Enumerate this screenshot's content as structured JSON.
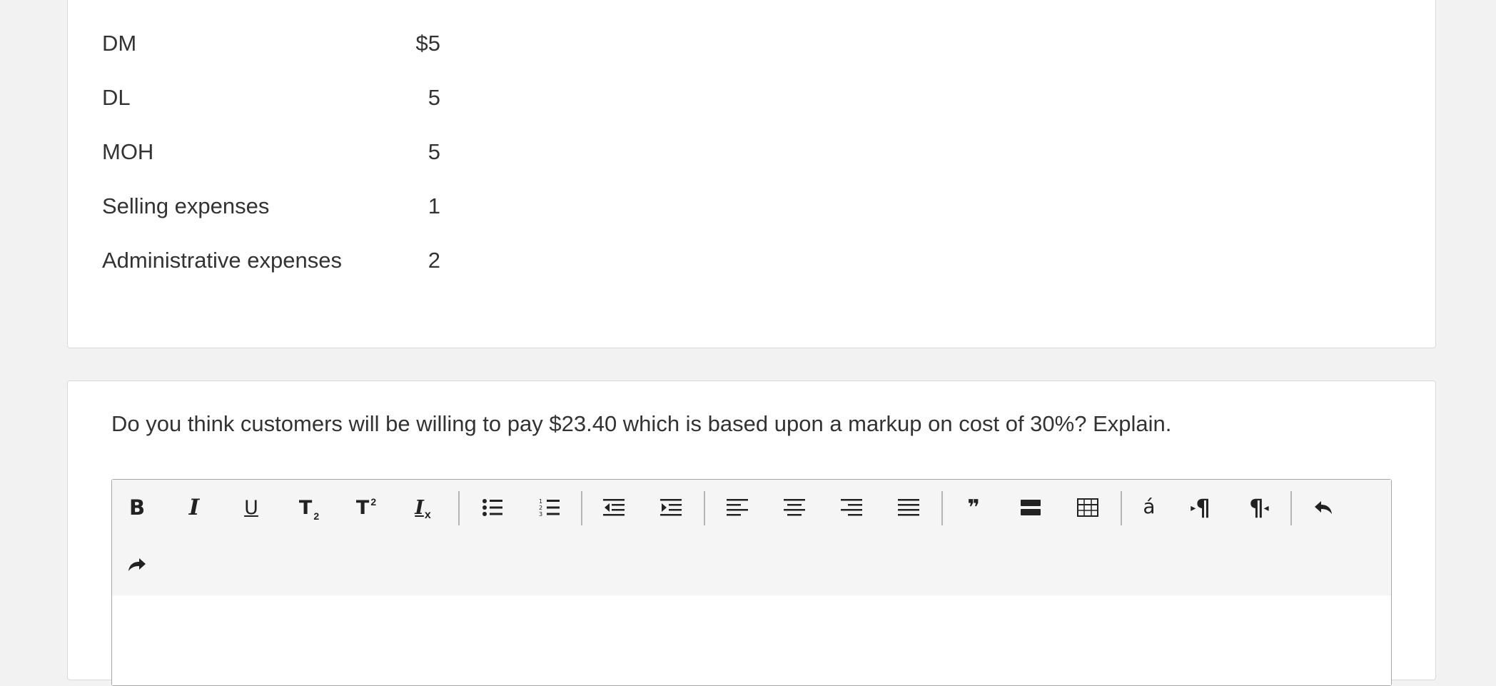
{
  "cost_table": {
    "rows": [
      {
        "label": "DM",
        "value": "$5"
      },
      {
        "label": "DL",
        "value": "5"
      },
      {
        "label": "MOH",
        "value": "5"
      },
      {
        "label": "Selling expenses",
        "value": "1"
      },
      {
        "label": "Administrative expenses",
        "value": "2"
      }
    ]
  },
  "question": {
    "text": "Do you think customers will be willing to pay $23.40 which is based upon a markup on cost of 30%? Explain."
  },
  "editor": {
    "body_text": "",
    "toolbar": [
      {
        "name": "bold",
        "icon": "bold-icon",
        "glyph": "B"
      },
      {
        "name": "italic",
        "icon": "italic-icon",
        "glyph": "I"
      },
      {
        "name": "underline",
        "icon": "underline-icon",
        "glyph": "U"
      },
      {
        "name": "subscript",
        "icon": "subscript-icon",
        "glyph": "T",
        "sub": "2"
      },
      {
        "name": "superscript",
        "icon": "superscript-icon",
        "glyph": "T",
        "sup": "2"
      },
      {
        "name": "remove-format",
        "icon": "remove-format-icon",
        "glyph": "I",
        "sub": "x"
      },
      {
        "name": "bulleted-list",
        "icon": "bulleted-list-icon"
      },
      {
        "name": "numbered-list",
        "icon": "numbered-list-icon"
      },
      {
        "name": "decrease-indent",
        "icon": "outdent-icon"
      },
      {
        "name": "increase-indent",
        "icon": "indent-icon"
      },
      {
        "name": "align-left",
        "icon": "align-left-icon"
      },
      {
        "name": "align-center",
        "icon": "align-center-icon"
      },
      {
        "name": "align-right",
        "icon": "align-right-icon"
      },
      {
        "name": "justify",
        "icon": "justify-icon"
      },
      {
        "name": "blockquote",
        "icon": "quote-icon",
        "glyph": "❞"
      },
      {
        "name": "horizontal-line",
        "icon": "horizontal-line-icon"
      },
      {
        "name": "table",
        "icon": "table-icon"
      },
      {
        "name": "special-character",
        "icon": "special-character-icon",
        "glyph": "á"
      },
      {
        "name": "ltr-direction",
        "icon": "ltr-paragraph-icon",
        "glyph": "¶"
      },
      {
        "name": "rtl-direction",
        "icon": "rtl-paragraph-icon",
        "glyph": "¶"
      },
      {
        "name": "undo",
        "icon": "undo-icon"
      },
      {
        "name": "redo",
        "icon": "redo-icon"
      }
    ]
  }
}
